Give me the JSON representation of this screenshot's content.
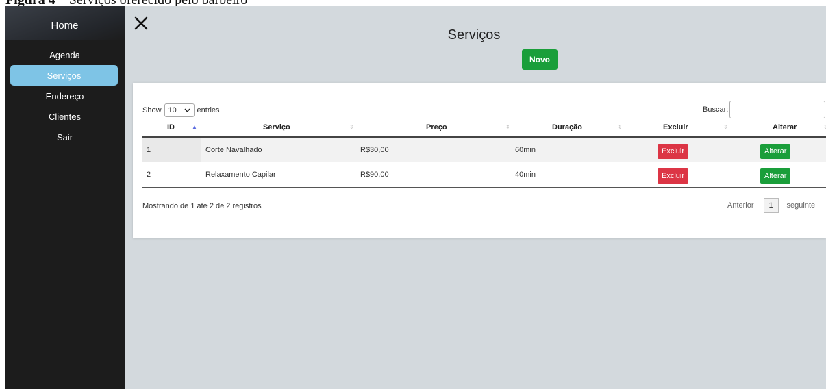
{
  "caption": {
    "prefix": "Figura 4",
    "rest": " – Serviços oferecido pelo barbeiro"
  },
  "sidebar": {
    "home": "Home",
    "items": [
      {
        "label": "Agenda",
        "active": false
      },
      {
        "label": "Serviços",
        "active": true
      },
      {
        "label": "Endereço",
        "active": false
      },
      {
        "label": "Clientes",
        "active": false
      },
      {
        "label": "Sair",
        "active": false
      }
    ],
    "active_color": "#7ec4e6",
    "background": "#1c1c1c"
  },
  "main": {
    "close_icon": "close-icon",
    "title": "Serviços",
    "new_button": "Novo",
    "background": "#d3d9dd"
  },
  "table": {
    "show_label": "Show",
    "show_value": "10",
    "entries_label": "entries",
    "search_label": "Buscar:",
    "search_value": "",
    "columns": [
      "ID",
      "Serviço",
      "Preço",
      "Duração",
      "Excluir",
      "Alterar"
    ],
    "sorted_column": "ID",
    "rows": [
      {
        "id": "1",
        "servico": "Corte Navalhado",
        "preco": "R$30,00",
        "duracao": "60min",
        "excluir": "Excluir",
        "alterar": "Alterar"
      },
      {
        "id": "2",
        "servico": "Relaxamento Capilar",
        "preco": "R$90,00",
        "duracao": "40min",
        "excluir": "Excluir",
        "alterar": "Alterar"
      }
    ],
    "info": "Mostrando de 1 até 2 de 2 registros",
    "pagination": {
      "previous": "Anterior",
      "current": "1",
      "next": "seguinte"
    },
    "colors": {
      "danger": "#dc3545",
      "success": "#1a9e3a"
    }
  }
}
